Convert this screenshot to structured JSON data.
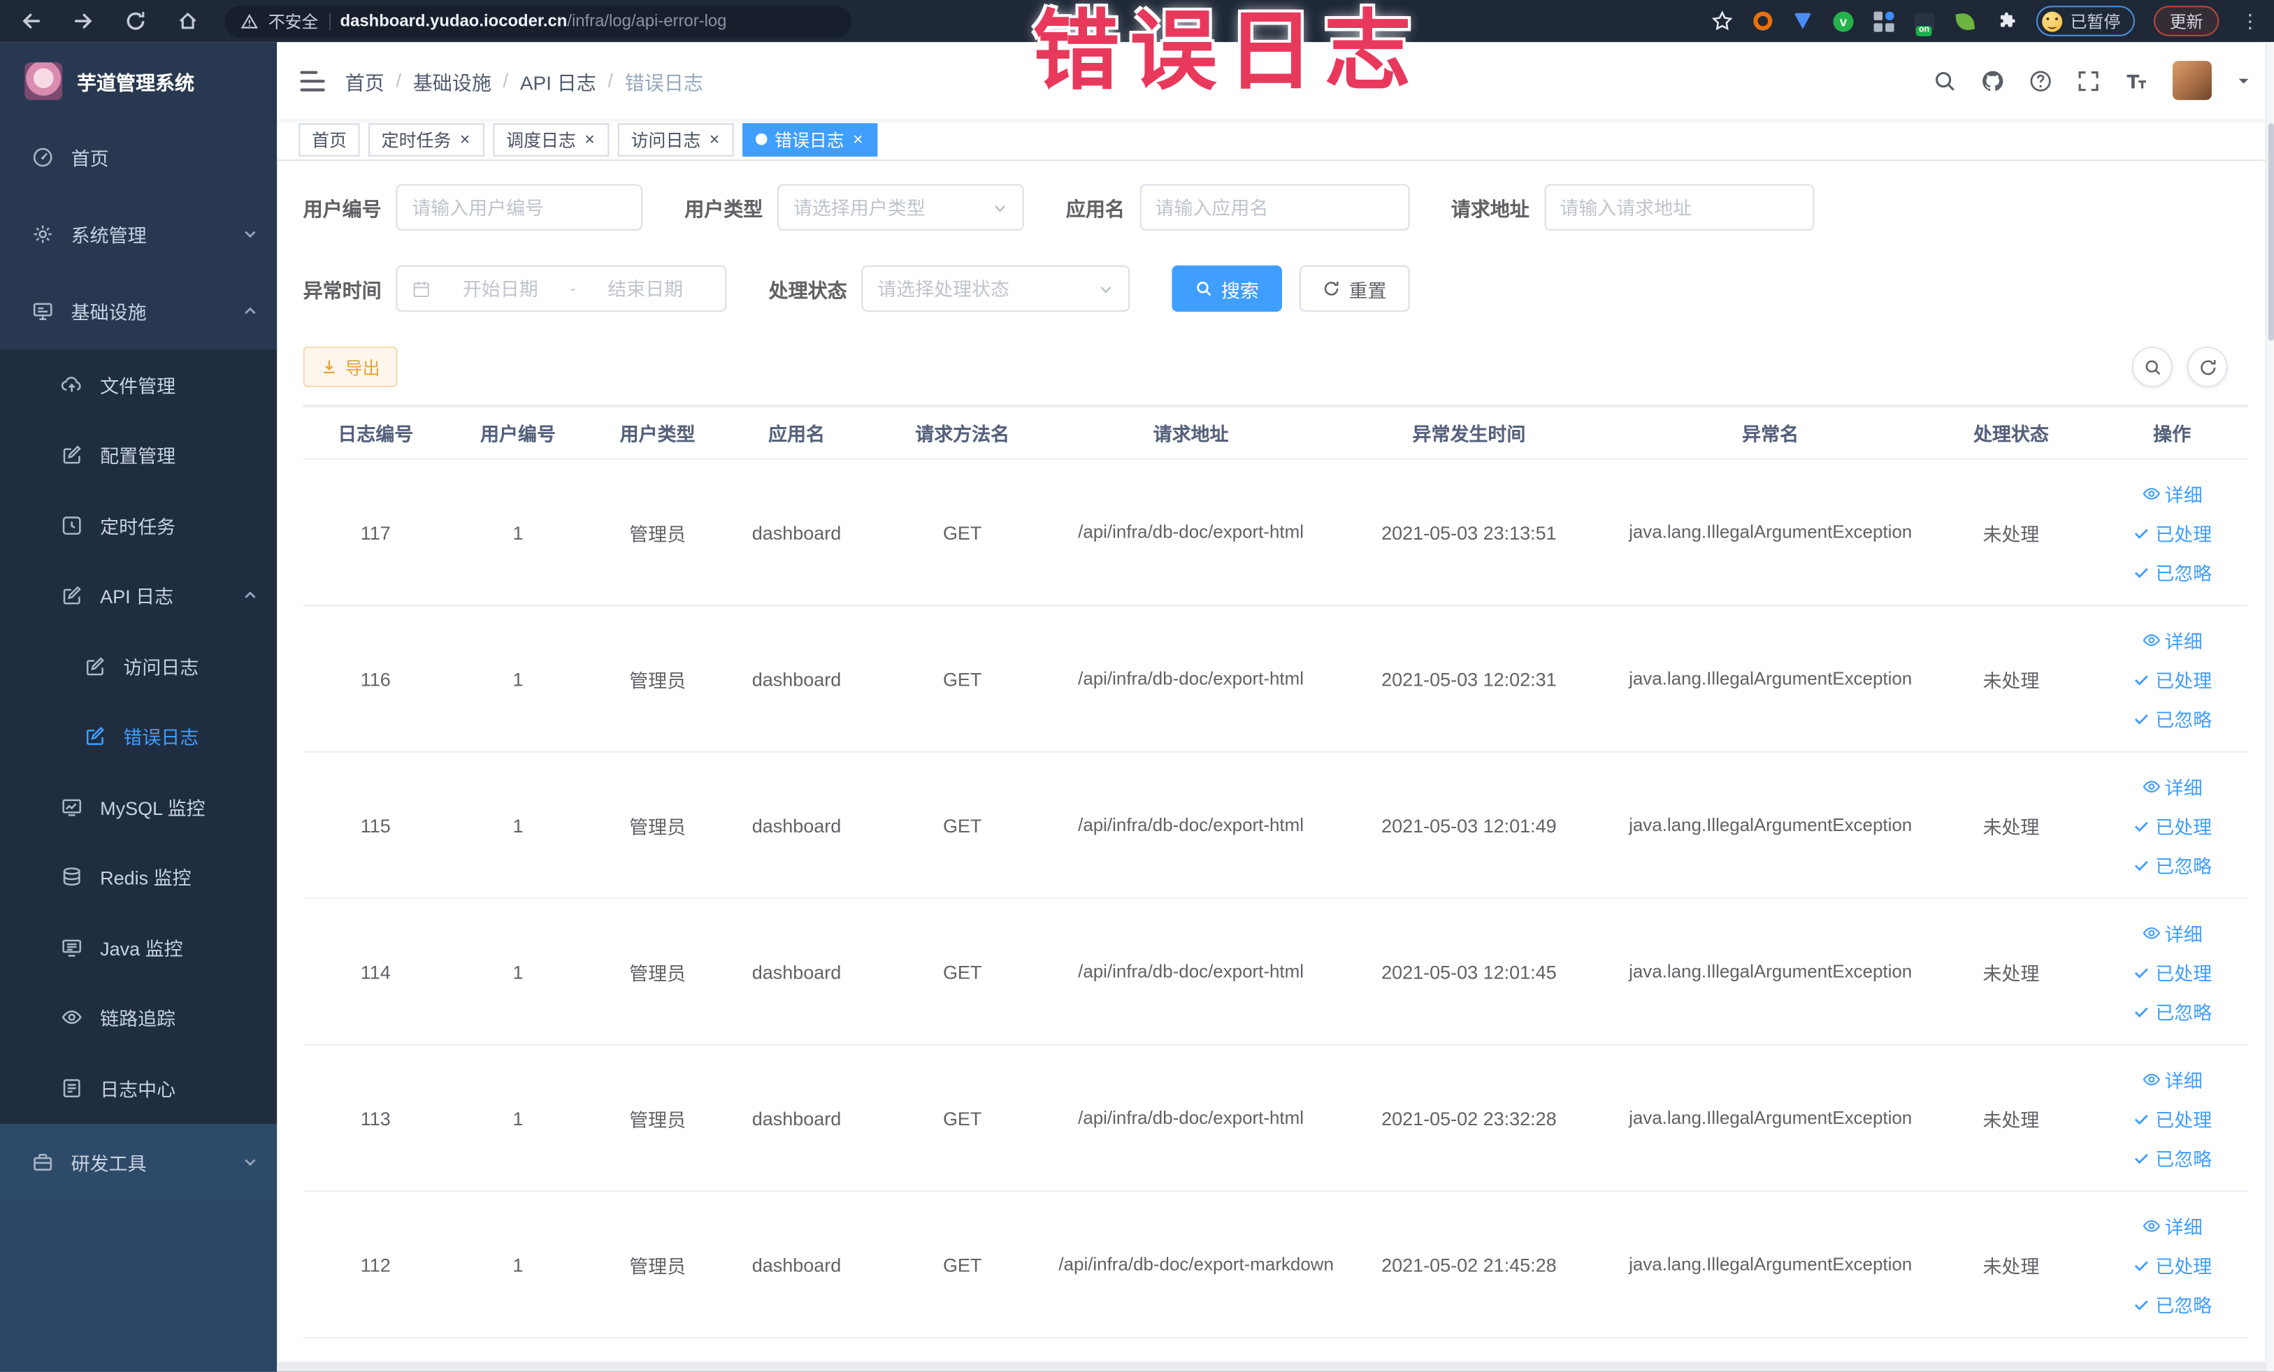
{
  "annotation": {
    "text": "错误日志",
    "color": "#e8395c"
  },
  "browser": {
    "nav_icons": [
      "back-icon",
      "forward-icon",
      "reload-icon",
      "home-icon"
    ],
    "security_label": "不安全",
    "url_host": "dashboard.yudao.iocoder.cn",
    "url_path": "/infra/log/api-error-log",
    "paused_label": "已暂停",
    "update_label": "更新"
  },
  "sidebar": {
    "title": "芋道管理系统",
    "menu": [
      {
        "label": "首页",
        "icon": "home-icon",
        "level": 1
      },
      {
        "label": "系统管理",
        "icon": "gear-icon",
        "level": 1,
        "chevron": "down"
      },
      {
        "label": "基础设施",
        "icon": "monitor-icon",
        "level": 1,
        "chevron": "up"
      },
      {
        "label": "文件管理",
        "icon": "cloud-upload-icon",
        "level": 2
      },
      {
        "label": "配置管理",
        "icon": "edit-icon",
        "level": 2
      },
      {
        "label": "定时任务",
        "icon": "timer-icon",
        "level": 2
      },
      {
        "label": "API 日志",
        "icon": "log-icon",
        "level": 2,
        "chevron": "up"
      },
      {
        "label": "访问日志",
        "icon": "log-icon",
        "level": 3
      },
      {
        "label": "错误日志",
        "icon": "log-icon",
        "level": 3,
        "active": true
      },
      {
        "label": "MySQL 监控",
        "icon": "database-monitor-icon",
        "level": 2
      },
      {
        "label": "Redis 监控",
        "icon": "layers-icon",
        "level": 2
      },
      {
        "label": "Java 监控",
        "icon": "java-monitor-icon",
        "level": 2
      },
      {
        "label": "链路追踪",
        "icon": "trace-eye-icon",
        "level": 2
      },
      {
        "label": "日志中心",
        "icon": "log-center-icon",
        "level": 2
      },
      {
        "label": "研发工具",
        "icon": "toolbox-icon",
        "level": 1,
        "chevron": "down",
        "section": "light"
      }
    ]
  },
  "header": {
    "breadcrumb": [
      "首页",
      "基础设施",
      "API 日志",
      "错误日志"
    ],
    "action_icons": [
      "search-icon",
      "github-icon",
      "help-icon",
      "fullscreen-icon",
      "font-size-icon",
      "avatar",
      "chevron-down-icon"
    ]
  },
  "tabs": [
    {
      "label": "首页",
      "closable": false,
      "active": false
    },
    {
      "label": "定时任务",
      "closable": true,
      "active": false
    },
    {
      "label": "调度日志",
      "closable": true,
      "active": false
    },
    {
      "label": "访问日志",
      "closable": true,
      "active": false
    },
    {
      "label": "错误日志",
      "closable": true,
      "active": true
    }
  ],
  "filters": {
    "user_id": {
      "label": "用户编号",
      "placeholder": "请输入用户编号"
    },
    "user_type": {
      "label": "用户类型",
      "placeholder": "请选择用户类型"
    },
    "app_name": {
      "label": "应用名",
      "placeholder": "请输入应用名"
    },
    "request_url": {
      "label": "请求地址",
      "placeholder": "请输入请求地址"
    },
    "exception_time": {
      "label": "异常时间",
      "start_placeholder": "开始日期",
      "separator": "-",
      "end_placeholder": "结束日期"
    },
    "process_status": {
      "label": "处理状态",
      "placeholder": "请选择处理状态"
    },
    "search_label": "搜索",
    "reset_label": "重置"
  },
  "toolbar": {
    "export_label": "导出"
  },
  "table": {
    "columns": [
      "日志编号",
      "用户编号",
      "用户类型",
      "应用名",
      "请求方法名",
      "请求地址",
      "异常发生时间",
      "异常名",
      "处理状态",
      "操作"
    ],
    "row_actions": [
      "详细",
      "已处理",
      "已忽略"
    ],
    "rows": [
      {
        "log_id": "117",
        "user_id": "1",
        "user_type": "管理员",
        "app_name": "dashboard",
        "method": "GET",
        "url": "/api/infra/db-doc/export-html",
        "time": "2021-05-03 23:13:51",
        "exception": "java.lang.IllegalArgumentException",
        "status": "未处理"
      },
      {
        "log_id": "116",
        "user_id": "1",
        "user_type": "管理员",
        "app_name": "dashboard",
        "method": "GET",
        "url": "/api/infra/db-doc/export-html",
        "time": "2021-05-03 12:02:31",
        "exception": "java.lang.IllegalArgumentException",
        "status": "未处理"
      },
      {
        "log_id": "115",
        "user_id": "1",
        "user_type": "管理员",
        "app_name": "dashboard",
        "method": "GET",
        "url": "/api/infra/db-doc/export-html",
        "time": "2021-05-03 12:01:49",
        "exception": "java.lang.IllegalArgumentException",
        "status": "未处理"
      },
      {
        "log_id": "114",
        "user_id": "1",
        "user_type": "管理员",
        "app_name": "dashboard",
        "method": "GET",
        "url": "/api/infra/db-doc/export-html",
        "time": "2021-05-03 12:01:45",
        "exception": "java.lang.IllegalArgumentException",
        "status": "未处理"
      },
      {
        "log_id": "113",
        "user_id": "1",
        "user_type": "管理员",
        "app_name": "dashboard",
        "method": "GET",
        "url": "/api/infra/db-doc/export-html",
        "time": "2021-05-02 23:32:28",
        "exception": "java.lang.IllegalArgumentException",
        "status": "未处理"
      },
      {
        "log_id": "112",
        "user_id": "1",
        "user_type": "管理员",
        "app_name": "dashboard",
        "method": "GET",
        "url": "/api/infra/db-doc/export-markdown",
        "time": "2021-05-02 21:45:28",
        "exception": "java.lang.IllegalArgumentException",
        "status": "未处理"
      }
    ]
  },
  "colors": {
    "accent": "#409eff",
    "annotation": "#e8395c",
    "export_warning": "#e6a23c",
    "sidebar_bg": "#273850",
    "submenu_bg": "#1f2d40"
  }
}
